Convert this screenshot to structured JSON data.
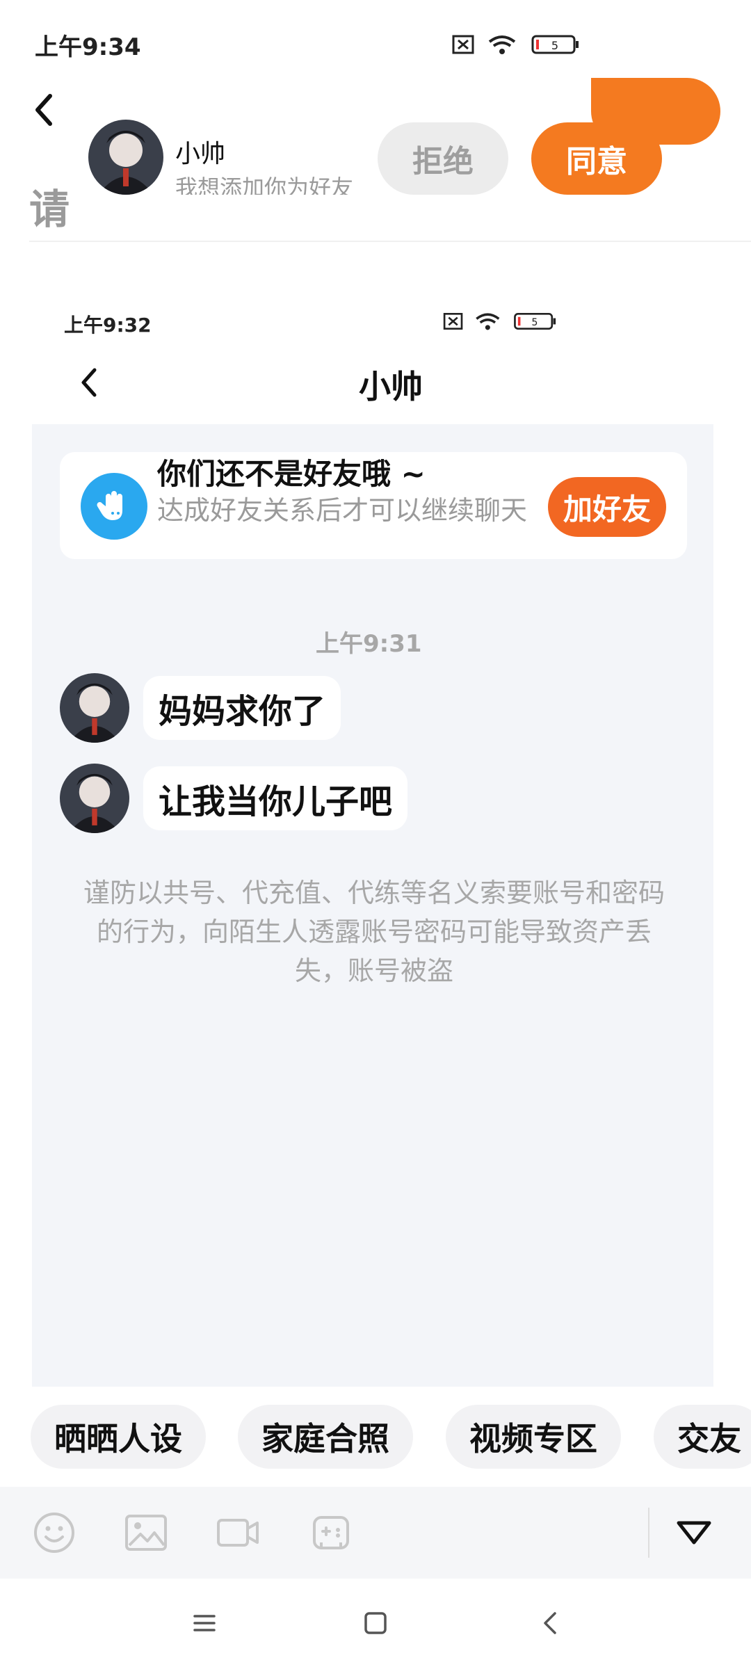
{
  "outer_status": {
    "time": "上午9:34",
    "battery": "5",
    "icons": [
      "no-sim-icon",
      "wifi-icon",
      "battery-icon"
    ]
  },
  "friend_request": {
    "name": "小帅",
    "message": "我想添加你为好友",
    "reject_label": "拒绝",
    "accept_label": "同意",
    "background_title_fragment": "请"
  },
  "inner_status": {
    "time": "上午9:32",
    "battery": "5"
  },
  "chat": {
    "title": "小帅",
    "notice": {
      "title": "你们还不是好友哦 ~",
      "subtitle": "达成好友关系后才可以继续聊天",
      "add_label": "加好友"
    },
    "timestamp": "上午9:31",
    "messages": [
      {
        "text": "妈妈求你了"
      },
      {
        "text": "让我当你儿子吧"
      }
    ],
    "safety_warning": "谨防以共号、代充值、代练等名义索要账号和密码的行为，向陌生人透露账号密码可能导致资产丢失，账号被盗"
  },
  "topics": [
    "晒晒人设",
    "家庭合照",
    "视频专区",
    "交友"
  ],
  "toolbar_icons": [
    "emoji-icon",
    "image-icon",
    "video-icon",
    "game-icon",
    "expand-icon"
  ],
  "nav_icons": [
    "menu-icon",
    "home-icon",
    "back-icon"
  ],
  "colors": {
    "accent": "#f47a20",
    "add_friend": "#f26722",
    "notice_icon": "#2aa8ef",
    "chat_background": "#f3f5f9"
  }
}
